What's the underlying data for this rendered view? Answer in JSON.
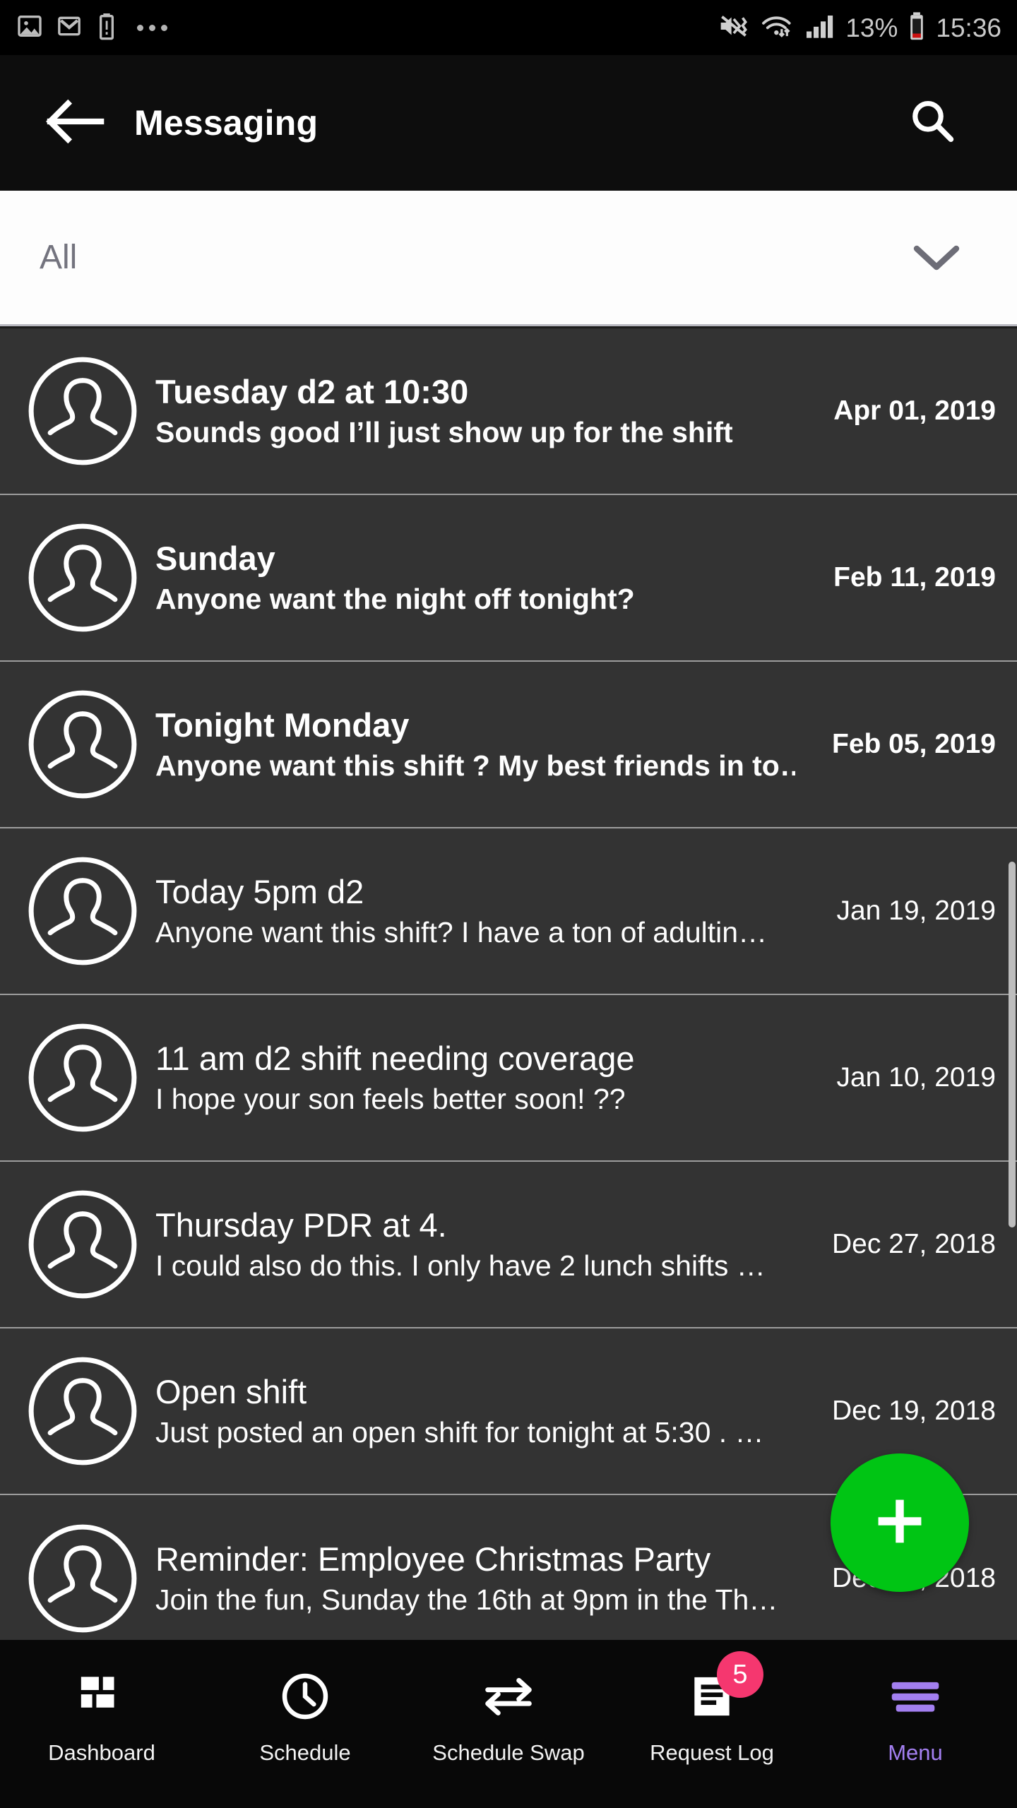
{
  "status_bar": {
    "left_icons": [
      "gallery-icon",
      "gmail-icon",
      "battery-warning-icon",
      "overflow-dots-icon"
    ],
    "right_icons": [
      "volume-mute-vibrate-icon",
      "wifi-data-icon",
      "cell-signal-icon",
      "battery-low-icon"
    ],
    "battery_percent": "13%",
    "clock": "15:36"
  },
  "app_bar": {
    "back_icon": "arrow-left-icon",
    "title": "Messaging",
    "search_icon": "search-icon"
  },
  "filter": {
    "selected": "All",
    "chevron_icon": "chevron-down-icon",
    "options": [
      "All"
    ]
  },
  "messages": [
    {
      "avatar": "person-placeholder-icon",
      "title": "Tuesday d2 at 10:30",
      "snippet": "Sounds good I’ll just show up for the shift",
      "date": "Apr 01, 2019",
      "unread": true
    },
    {
      "avatar": "person-placeholder-icon",
      "title": "Sunday",
      "snippet": "Anyone want the night off tonight?",
      "date": "Feb 11, 2019",
      "unread": true
    },
    {
      "avatar": "person-placeholder-icon",
      "title": "Tonight Monday",
      "snippet": "Anyone want this shift ? My best friends in to…",
      "date": "Feb 05, 2019",
      "unread": true
    },
    {
      "avatar": "person-placeholder-icon",
      "title": "Today 5pm  d2",
      "snippet": "Anyone want this shift? I have a ton of adultin…",
      "date": "Jan 19, 2019",
      "unread": false
    },
    {
      "avatar": "person-placeholder-icon",
      "title": "11 am  d2 shift needing coverage",
      "snippet": "I hope your son feels better soon! ??",
      "date": "Jan 10, 2019",
      "unread": false
    },
    {
      "avatar": "person-placeholder-icon",
      "title": "Thursday PDR at 4.",
      "snippet": "I could also do this. I only have 2 lunch shifts …",
      "date": "Dec 27, 2018",
      "unread": false
    },
    {
      "avatar": "person-placeholder-icon",
      "title": "Open shift",
      "snippet": "Just posted an open shift for tonight at 5:30 . …",
      "date": "Dec 19, 2018",
      "unread": false
    },
    {
      "avatar": "person-placeholder-icon",
      "title": "Reminder: Employee Christmas Party",
      "snippet": "Join the fun, Sunday the 16th at 9pm in the Th…",
      "date": "Dec 12, 2018",
      "unread": false
    }
  ],
  "fab": {
    "icon": "plus-icon",
    "color": "#00c514"
  },
  "bottom_nav": {
    "active_color": "#a37ff0",
    "badge_color": "#f5376f",
    "items": [
      {
        "label": "Dashboard",
        "icon": "dashboard-grid-icon",
        "badge": "",
        "active": false
      },
      {
        "label": "Schedule",
        "icon": "clock-icon",
        "badge": "",
        "active": false
      },
      {
        "label": "Schedule Swap",
        "icon": "swap-arrows-icon",
        "badge": "",
        "active": false
      },
      {
        "label": "Request Log",
        "icon": "clipboard-icon",
        "badge": "5",
        "active": false
      },
      {
        "label": "Menu",
        "icon": "hamburger-menu-icon",
        "badge": "",
        "active": true
      }
    ]
  }
}
